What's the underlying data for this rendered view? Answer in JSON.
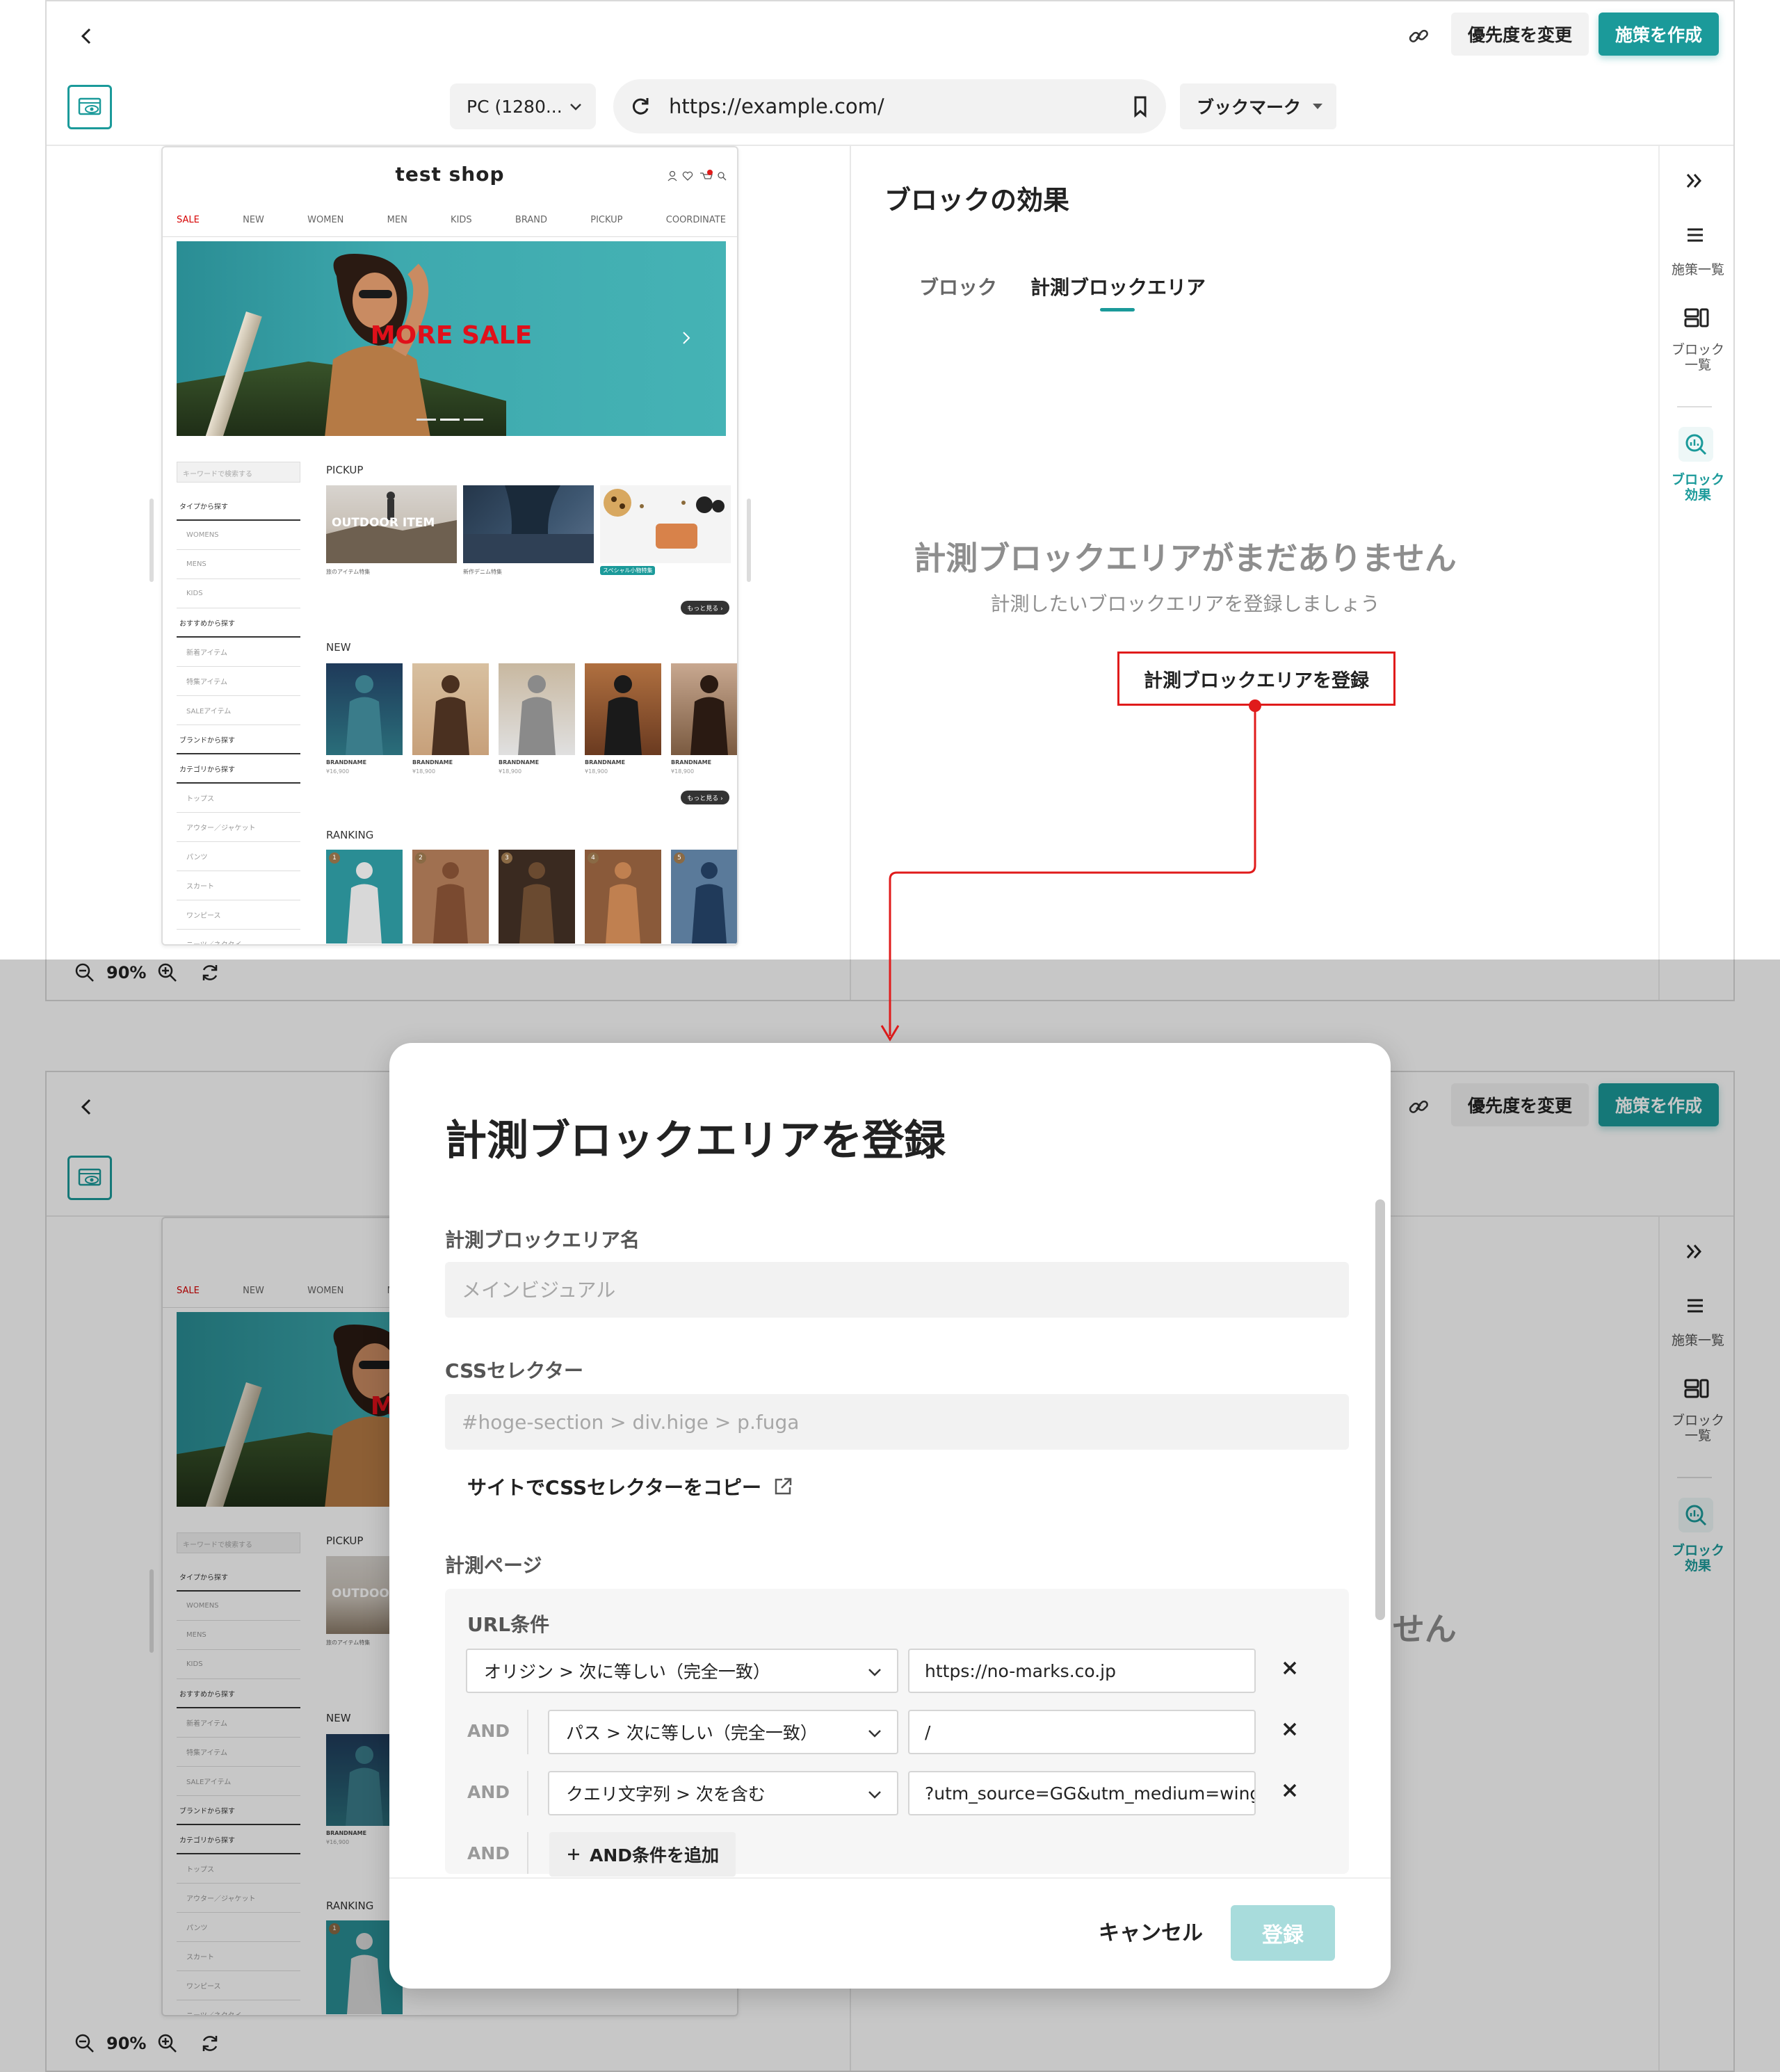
{
  "colors": {
    "accent": "#1b9a9a",
    "annotation": "#e01b1b",
    "accent_disabled": "#a8dcdc"
  },
  "top_bar": {
    "back_icon": "chevron-left-icon",
    "link_icon": "link-icon",
    "priority_label": "優先度を変更",
    "create_label": "施策を作成"
  },
  "toolbar": {
    "preview_icon": "eye-window-icon",
    "device": "PC (1280...",
    "url": "https://example.com/",
    "bookmark_label": "ブックマーク"
  },
  "shop": {
    "title": "test shop",
    "nav": [
      "SALE",
      "NEW",
      "WOMEN",
      "MEN",
      "KIDS",
      "BRAND",
      "PICKUP",
      "COORDINATE"
    ],
    "hero_text": "MORE SALE",
    "search_placeholder": "キーワードで検索する",
    "sidebar": [
      {
        "label": "タイプから探す",
        "kind": "strong"
      },
      {
        "label": "WOMENS",
        "kind": "sub"
      },
      {
        "label": "MENS",
        "kind": "sub"
      },
      {
        "label": "KIDS",
        "kind": "sub"
      },
      {
        "label": "おすすめから探す",
        "kind": "strong"
      },
      {
        "label": "新着アイテム",
        "kind": "sub"
      },
      {
        "label": "特集アイテム",
        "kind": "sub"
      },
      {
        "label": "SALEアイテム",
        "kind": "sub"
      },
      {
        "label": "ブランドから探す",
        "kind": "strong"
      },
      {
        "label": "カテゴリから探す",
        "kind": "strong"
      },
      {
        "label": "トップス",
        "kind": "sub"
      },
      {
        "label": "アウター／ジャケット",
        "kind": "sub"
      },
      {
        "label": "パンツ",
        "kind": "sub"
      },
      {
        "label": "スカート",
        "kind": "sub"
      },
      {
        "label": "ワンピース",
        "kind": "sub"
      },
      {
        "label": "ニーツ／ネクタイ",
        "kind": "sub"
      }
    ],
    "pickup_label": "PICKUP",
    "pickup_banner_text": "OUTDOOR ITEM",
    "pickup_captions": [
      "旅のアイテム特集",
      "新作デニム特集",
      "スペシャル小物特集"
    ],
    "new_label": "NEW",
    "brand_name": "BRANDNAME",
    "prices": [
      "¥16,900",
      "¥18,900",
      "¥18,900",
      "¥18,900",
      "¥18,900"
    ],
    "more_label": "もっと見る ›",
    "ranking_label": "RANKING",
    "ranks": [
      "1",
      "2",
      "3",
      "4",
      "5"
    ]
  },
  "panel": {
    "title": "ブロックの効果",
    "tabs": [
      "ブロック",
      "計測ブロックエリア"
    ],
    "empty_title": "計測ブロックエリアがまだありません",
    "empty_sub": "計測したいブロックエリアを登録しましょう",
    "register_label": "計測ブロックエリアを登録"
  },
  "rail": {
    "items": [
      {
        "label": "施策一覧",
        "icon": "list-icon"
      },
      {
        "label": "ブロック\n一覧",
        "icon": "blocks-icon"
      },
      {
        "label": "ブロック\n効果",
        "icon": "chart-search-icon"
      }
    ]
  },
  "zoom": {
    "value": "90%"
  },
  "modal": {
    "title": "計測ブロックエリアを登録",
    "name_label": "計測ブロックエリア名",
    "name_placeholder": "メインビジュアル",
    "css_label": "CSSセレクター",
    "css_placeholder": "#hoge-section > div.hige > p.fuga",
    "copy_label": "サイトでCSSセレクターをコピー",
    "page_label": "計測ページ",
    "url_cond_label": "URL条件",
    "and_label": "AND",
    "conditions": [
      {
        "type": "オリジン > 次に等しい（完全一致）",
        "value": "https://no-marks.co.jp"
      },
      {
        "type": "パス > 次に等しい（完全一致）",
        "value": "/"
      },
      {
        "type": "クエリ文字列 > 次を含む",
        "value": "?utm_source=GG&utm_medium=wing..."
      }
    ],
    "add_and_label": "AND条件を追加",
    "cancel_label": "キャンセル",
    "submit_label": "登録"
  }
}
